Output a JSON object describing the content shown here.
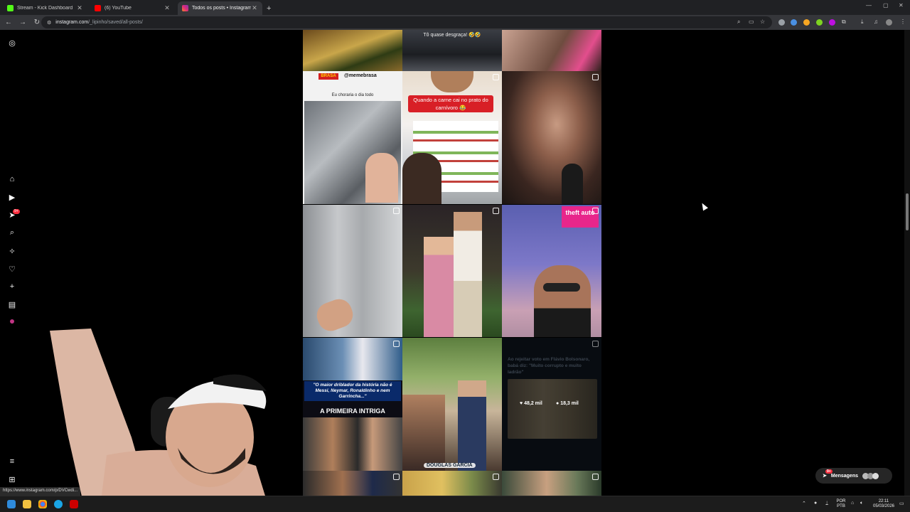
{
  "browser": {
    "tabs": [
      {
        "title": "Stream - Kick Dashboard",
        "color": "#53fc18"
      },
      {
        "title": "(6) YouTube",
        "color": "#ff0000"
      },
      {
        "title": "Todos os posts • Instagram",
        "color": "#e1306c"
      }
    ],
    "url_site": "instagram.com",
    "url_path": "/_lipinho/saved/all-posts/"
  },
  "posts": {
    "top_caption": "Tô quase desgraça! 🤣🤣",
    "memebrasa_handle": "@memebrasa",
    "memebrasa_brand": "BRASA",
    "memebrasa_caption": "Eu choraria o dia todo",
    "carnivoro_caption": "Quando a carne cai no prato do carnívoro 😂",
    "gta_label": "theft auto",
    "hover_title": "Ao rejeitar voto em Flávio Bolsonaro, babá diz: \"Muito corrupto e muito ladrão\"",
    "hover_likes": "48,2 mil",
    "hover_comments": "18,3 mil",
    "messi_quote": "\"O maior driblador da história não é Messi, Neymar, Ronaldinho e nem Garrincha...\"",
    "intriga_caption": "A PRIMEIRA INTRIGA",
    "douglas_caption": "DOUGLAS GARCIA"
  },
  "messages": {
    "label": "Mensagens",
    "badge": "9+"
  },
  "sidebar": {
    "notif_badge": "9+"
  },
  "status_url": "https://www.instagram.com/p/DVCwdi...",
  "taskbar": {
    "lang": "POR",
    "layout": "PTB",
    "time": "22:11",
    "date": "05/03/2026"
  }
}
